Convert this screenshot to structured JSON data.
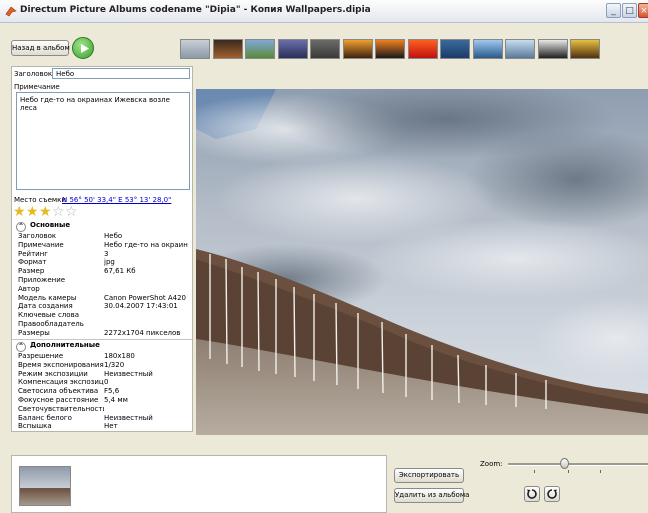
{
  "window": {
    "title": "Directum Picture Albums codename \"Dipia\" - Копия Wallpapers.dipia",
    "minimize_icon": "minimize-icon",
    "maximize_icon": "maximize-icon",
    "close_icon": "close-icon"
  },
  "toolbar": {
    "back_label": "Назад в альбом",
    "play_icon": "play-icon",
    "thumbnails": [
      {
        "name": "thumb-1",
        "colors": [
          "#c8cfd6",
          "#8a9aa6"
        ]
      },
      {
        "name": "thumb-2",
        "colors": [
          "#3a2a1e",
          "#a06030"
        ]
      },
      {
        "name": "thumb-3",
        "colors": [
          "#7fa8d8",
          "#5a8a3a"
        ]
      },
      {
        "name": "thumb-4",
        "colors": [
          "#6a6fa8",
          "#2a2e5a"
        ]
      },
      {
        "name": "thumb-5",
        "colors": [
          "#6a6a6a",
          "#3a3a3a"
        ]
      },
      {
        "name": "thumb-6",
        "colors": [
          "#f0a030",
          "#402010"
        ]
      },
      {
        "name": "thumb-7",
        "colors": [
          "#f08020",
          "#1a1a1a"
        ]
      },
      {
        "name": "thumb-8",
        "colors": [
          "#ff6020",
          "#c01010"
        ]
      },
      {
        "name": "thumb-9",
        "colors": [
          "#3a6a9a",
          "#1a3a6a"
        ]
      },
      {
        "name": "thumb-10",
        "colors": [
          "#a0c8f0",
          "#2a5a8a"
        ]
      },
      {
        "name": "thumb-11",
        "colors": [
          "#c8dcf0",
          "#5a7a9a"
        ]
      },
      {
        "name": "thumb-12",
        "colors": [
          "#e8e8e8",
          "#202020"
        ]
      },
      {
        "name": "thumb-13",
        "colors": [
          "#e8c040",
          "#503010"
        ]
      }
    ]
  },
  "details": {
    "title_label": "Заголовок",
    "title_value": "Небо",
    "note_label": "Примечание",
    "note_value": "Небо где-то на окраинах Ижевска возле леса",
    "location_label": "Место съемки",
    "location_value": "N 56° 50' 33,4\" E 53° 13' 28,0\"",
    "rating": 3,
    "rating_max": 5
  },
  "basic": {
    "header": "Основные",
    "rows": [
      {
        "k": "Заголовок",
        "v": "Небо"
      },
      {
        "k": "Примечание",
        "v": "Небо где-то на окраин"
      },
      {
        "k": "Рейтинг",
        "v": "3"
      },
      {
        "k": "Формат",
        "v": "jpg"
      },
      {
        "k": "Размер",
        "v": "67,61 Кб"
      },
      {
        "k": "Приложение",
        "v": ""
      },
      {
        "k": "Автор",
        "v": ""
      },
      {
        "k": "Модель камеры",
        "v": "Canon PowerShot A420"
      },
      {
        "k": "Дата создания",
        "v": "30.04.2007 17:43:01"
      },
      {
        "k": "Ключевые слова",
        "v": ""
      },
      {
        "k": "Правообладатель",
        "v": ""
      },
      {
        "k": "Размеры",
        "v": "2272x1704 пикселов"
      }
    ]
  },
  "extra": {
    "header": "Дополнительные",
    "rows": [
      {
        "k": "Разрешение",
        "v": "180x180"
      },
      {
        "k": "Время экспонирования",
        "v": "1/320"
      },
      {
        "k": "Режим экспозиции",
        "v": "Неизвестный"
      },
      {
        "k": "Компенсация экспозиции",
        "v": "0"
      },
      {
        "k": "Светосила объектива",
        "v": "F5,6"
      },
      {
        "k": "Фокусное расстояние",
        "v": "5,4 мм"
      },
      {
        "k": "Светочувствительность",
        "v": ""
      },
      {
        "k": "Баланс белого",
        "v": "Неизвестный"
      },
      {
        "k": "Вспышка",
        "v": "Нет"
      }
    ]
  },
  "bottom": {
    "export_label": "Экспортировать",
    "remove_label": "Удалить из альбома",
    "zoom_label": "Zoom:",
    "zoom_level": 0.4,
    "rotate_left_icon": "rotate-left-icon",
    "rotate_right_icon": "rotate-right-icon"
  }
}
